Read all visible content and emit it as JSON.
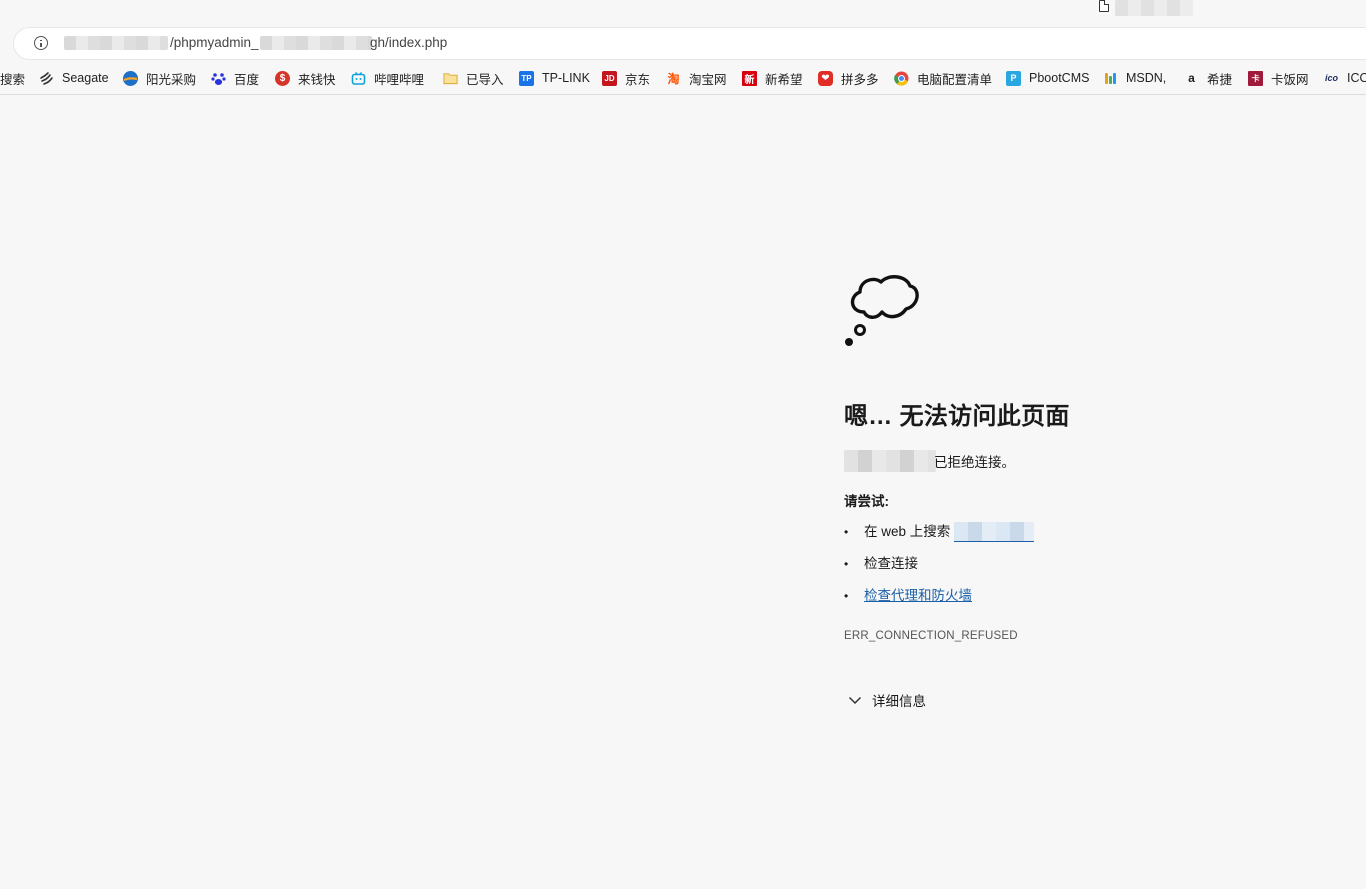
{
  "tab": {
    "title_obscured": true
  },
  "address_bar": {
    "url_part1": "/phpmyadmin_",
    "url_part2": "gh/index.php"
  },
  "bookmarks": [
    {
      "label": "搜索",
      "icon": "search-engine-icon",
      "color": "#1a73e8"
    },
    {
      "label": "Seagate",
      "icon": "seagate-icon",
      "color": "#333333"
    },
    {
      "label": "阳光采购",
      "icon": "globe-icon",
      "color": "#1e6fc7"
    },
    {
      "label": "百度",
      "icon": "baidu-paw-icon",
      "color": "#2932e1"
    },
    {
      "label": "来钱快",
      "icon": "money-icon",
      "color": "#d8352a"
    },
    {
      "label": "哔哩哔哩",
      "icon": "bilibili-tv-icon",
      "color": "#0fa3d8"
    },
    {
      "label": "已导入",
      "icon": "folder-icon",
      "color": "#e7b73c"
    },
    {
      "label": "TP-LINK",
      "icon": "tplink-icon",
      "color": "#1a73e8"
    },
    {
      "label": "京东",
      "icon": "jd-icon",
      "color": "#c4161c"
    },
    {
      "label": "淘宝网",
      "icon": "taobao-icon",
      "color": "#ff5000"
    },
    {
      "label": "新希望",
      "icon": "xinxiwang-icon",
      "color": "#d7000f"
    },
    {
      "label": "拼多多",
      "icon": "pinduoduo-icon",
      "color": "#e02e24"
    },
    {
      "label": "电脑配置清单",
      "icon": "chrome-like-icon",
      "color": "#e8453c"
    },
    {
      "label": "PbootCMS",
      "icon": "pbootcms-icon",
      "color": "#2aa7e0"
    },
    {
      "label": "MSDN,",
      "icon": "msdn-icon",
      "color": "#e4a11b"
    },
    {
      "label": "希捷",
      "icon": "amazon-icon",
      "color": "#222222"
    },
    {
      "label": "卡饭网",
      "icon": "kafan-icon",
      "color": "#a01b3b"
    },
    {
      "label": "ICO",
      "icon": "ico-icon",
      "color": "#1d2b5e"
    }
  ],
  "error_page": {
    "heading": "嗯… 无法访问此页面",
    "refused_suffix": "已拒绝连接。",
    "try_label": "请尝试:",
    "suggestions": {
      "search": "在 web 上搜索",
      "check_connection": "检查连接",
      "check_proxy": "检查代理和防火墙"
    },
    "error_code": "ERR_CONNECTION_REFUSED",
    "details_label": "详细信息"
  }
}
